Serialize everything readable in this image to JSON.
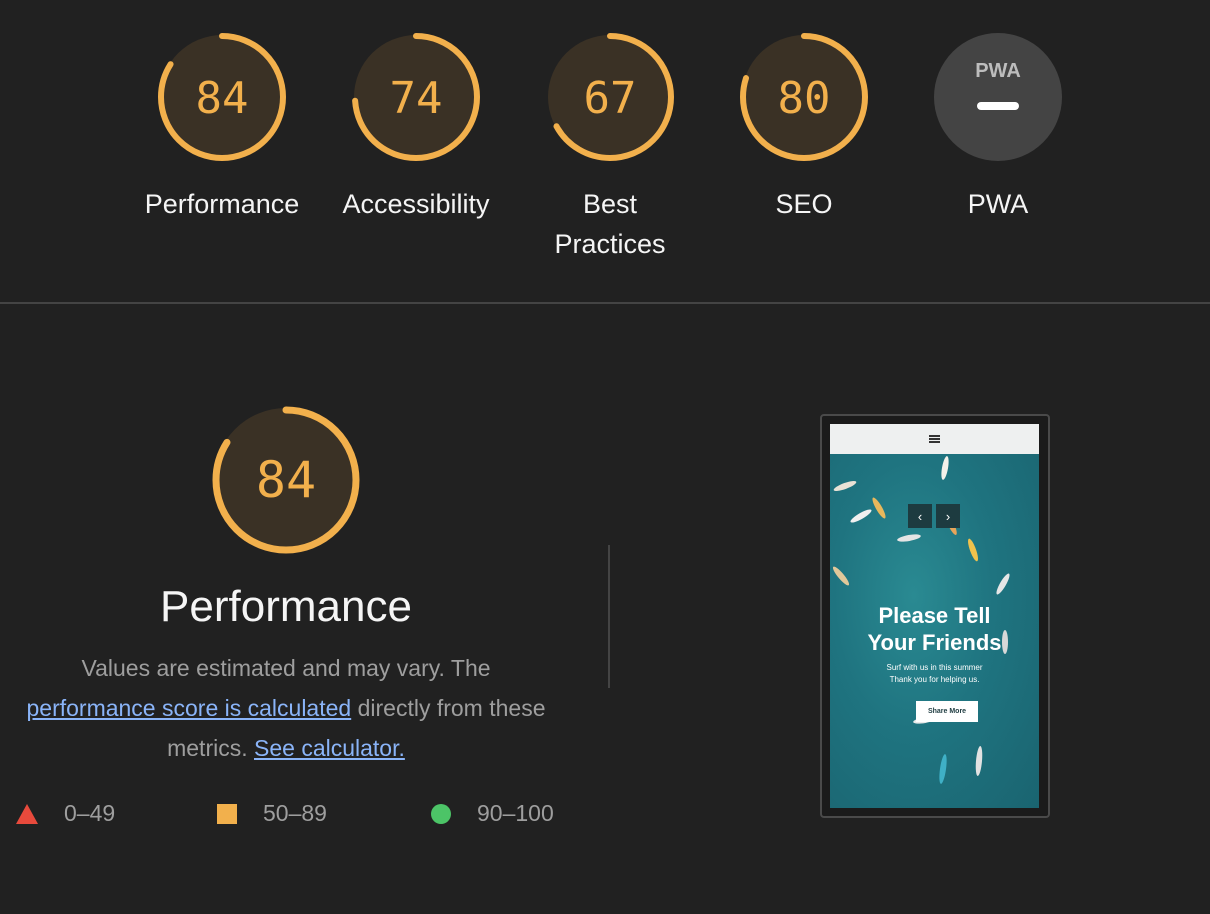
{
  "categories": [
    {
      "label": "Performance",
      "score": "84",
      "value": 84,
      "color": "#f2b04c"
    },
    {
      "label": "Accessibility",
      "score": "74",
      "value": 74,
      "color": "#f2b04c"
    },
    {
      "label": "Best Practices",
      "score": "67",
      "value": 67,
      "color": "#f2b04c"
    },
    {
      "label": "SEO",
      "score": "80",
      "value": 80,
      "color": "#f2b04c"
    },
    {
      "label": "PWA",
      "badge_text": "PWA"
    }
  ],
  "performance": {
    "score": "84",
    "value": 84,
    "title": "Performance",
    "desc_prefix": "Values are estimated and may vary. The",
    "desc_link1": "performance score is calculated",
    "desc_mid": "directly from these metrics.",
    "desc_link2": "See calculator."
  },
  "legend": [
    {
      "range": "0–49",
      "shape": "triangle",
      "color": "#e84a3c"
    },
    {
      "range": "50–89",
      "shape": "square",
      "color": "#f2b04c"
    },
    {
      "range": "90–100",
      "shape": "circle",
      "color": "#4cc467"
    }
  ],
  "screenshot": {
    "hero_title_line1": "Please Tell",
    "hero_title_line2": "Your Friends",
    "hero_sub_line1": "Surf with us in this summer",
    "hero_sub_line2": "Thank you for helping us.",
    "button_label": "Share More",
    "prev_icon": "chevron-left-icon",
    "next_icon": "chevron-right-icon",
    "menu_icon": "hamburger-menu-icon"
  },
  "colors": {
    "background": "#212121",
    "gauge_fill": "#3a3125",
    "gauge_average": "#f2b04c",
    "pwa_fill": "#444444",
    "link": "#8ab4f8",
    "muted_text": "#9e9e9e"
  }
}
